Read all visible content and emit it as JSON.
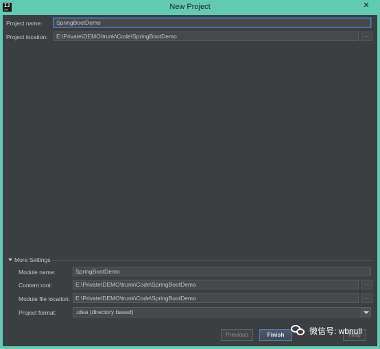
{
  "window": {
    "title": "New Project",
    "app_icon_text": "IJ",
    "close_glyph": "✕"
  },
  "project": {
    "name_label": "Project name:",
    "name_value": "SpringBootDemo",
    "location_label": "Project location:",
    "location_value": "E:\\Private\\DEMO\\trunk\\Code\\SpringBootDemo",
    "browse_glyph": "..."
  },
  "more_settings": {
    "label": "More Settings",
    "expanded": true,
    "module_name_label": "Module name:",
    "module_name_value": "SpringBootDemo",
    "content_root_label": "Content root:",
    "content_root_value": "E:\\Private\\DEMO\\trunk\\Code\\SpringBootDemo",
    "module_file_label": "Module file location:",
    "module_file_value": "E:\\Private\\DEMO\\trunk\\Code\\SpringBootDemo",
    "format_label": "Project format:",
    "format_value": ".idea (directory based)"
  },
  "buttons": {
    "previous": "Previous",
    "finish": "Finish",
    "help": "Help"
  },
  "watermark": {
    "text": "微信号: wbnull"
  },
  "colors": {
    "titlebar": "#62c9b3",
    "content_bg": "#3b3f42",
    "focus_border": "#4a88c7"
  }
}
